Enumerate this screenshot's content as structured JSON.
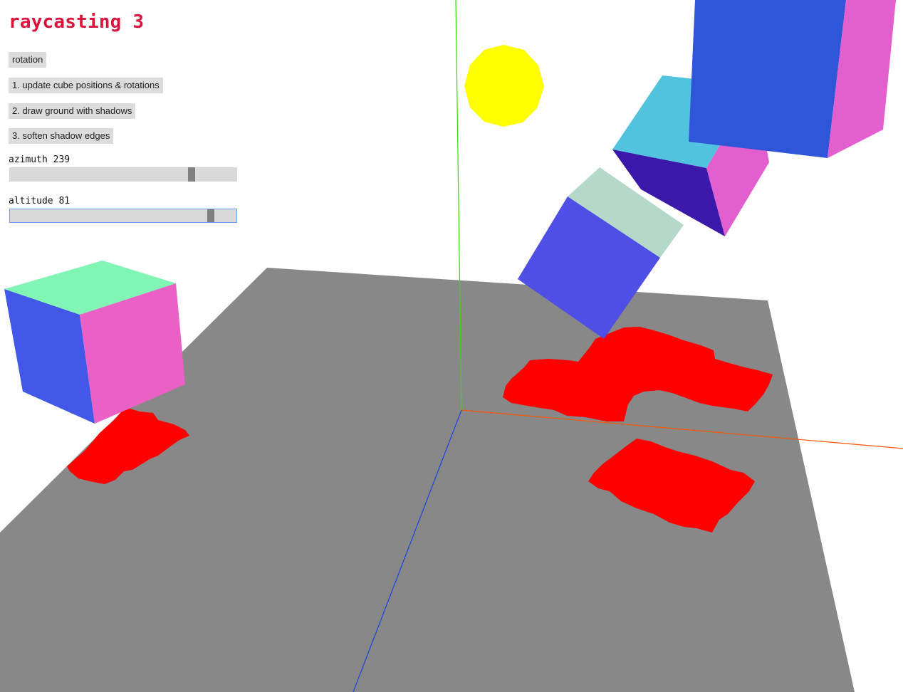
{
  "page": {
    "title": "raycasting 3"
  },
  "controls": {
    "buttons": [
      {
        "label": "rotation"
      },
      {
        "label": "1. update cube positions & rotations"
      },
      {
        "label": "2. draw ground with shadows"
      },
      {
        "label": "3. soften shadow edges"
      }
    ],
    "azimuth": {
      "label": "azimuth",
      "value": "239",
      "fraction": 0.81
    },
    "altitude": {
      "label": "altitude",
      "value": "81",
      "fraction": 0.9
    }
  },
  "colors": {
    "title": "#dc143c",
    "ground": "#888888",
    "shadow": "#ff0000",
    "sun": "#ffff00",
    "axis_x": "#ff5500",
    "axis_y": "#33dd00",
    "axis_z": "#1a44dd",
    "slider_track": "#d9d9d9",
    "slider_thumb": "#808080",
    "slider_focus": "#6c9ef8"
  }
}
